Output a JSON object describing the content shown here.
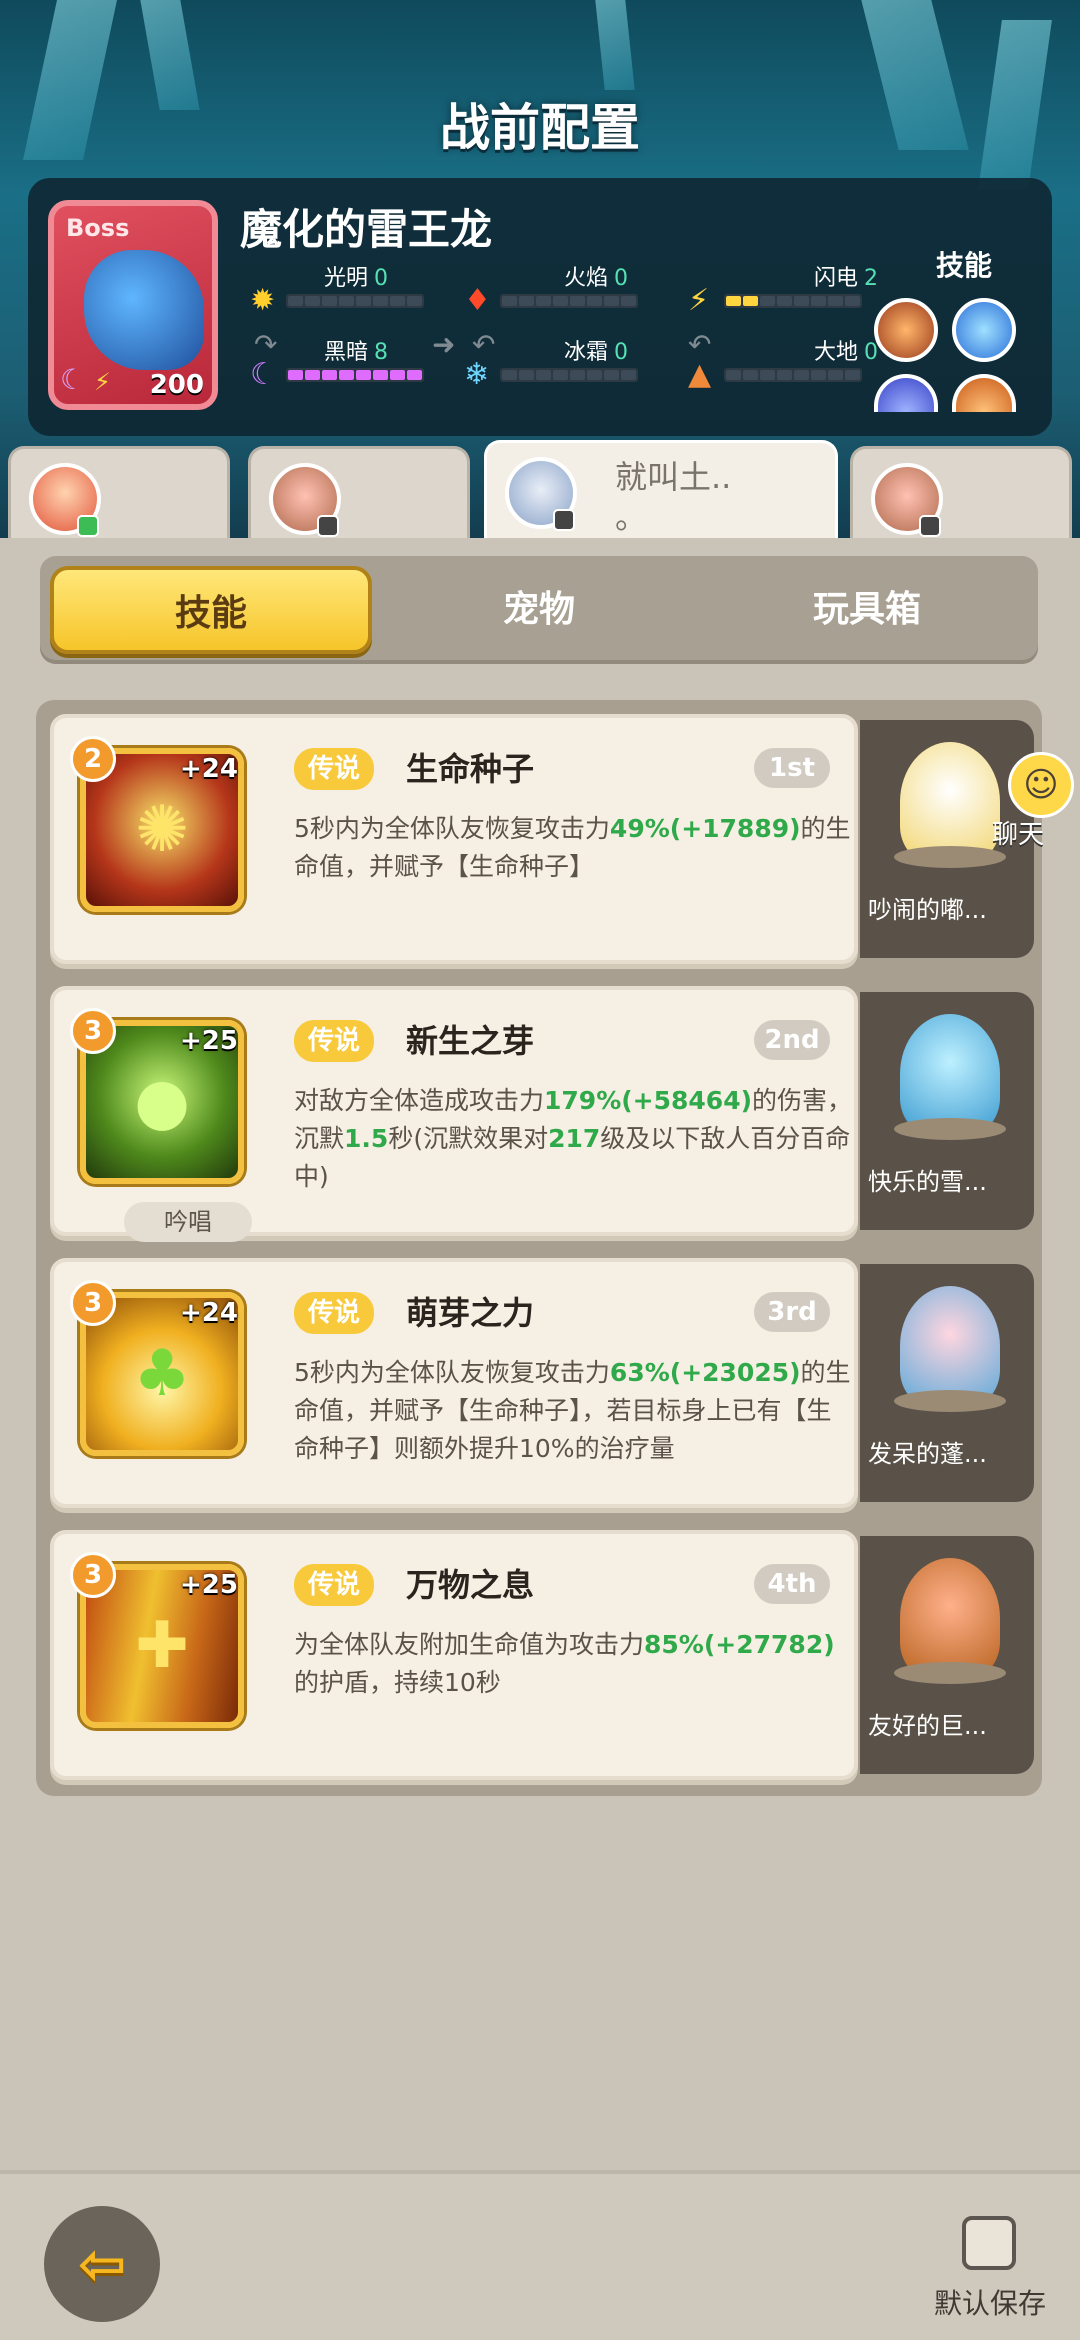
{
  "header": {
    "title": "战前配置"
  },
  "boss": {
    "tag": "Boss",
    "name": "魔化的雷王龙",
    "level": "200",
    "elements": [
      {
        "label": "光明",
        "value": "0",
        "icon": "sun-icon",
        "filled": 0
      },
      {
        "label": "火焰",
        "value": "0",
        "icon": "flame-icon",
        "filled": 0
      },
      {
        "label": "闪电",
        "value": "2",
        "icon": "bolt-icon",
        "filled": 2
      },
      {
        "label": "黑暗",
        "value": "8",
        "icon": "moon-icon",
        "filled": 8
      },
      {
        "label": "冰霜",
        "value": "0",
        "icon": "snowflake-icon",
        "filled": 0
      },
      {
        "label": "大地",
        "value": "0",
        "icon": "mountain-icon",
        "filled": 0
      }
    ],
    "skills_label": "技能"
  },
  "party": {
    "tabs": [
      {
        "name": ""
      },
      {
        "name": ""
      },
      {
        "name": "就叫土..\n。"
      },
      {
        "name": ""
      }
    ]
  },
  "tabs": [
    {
      "label": "技能",
      "active": true
    },
    {
      "label": "宠物",
      "active": false
    },
    {
      "label": "玩具箱",
      "active": false
    }
  ],
  "skills": [
    {
      "cost": "2",
      "bonus": "+24",
      "tag": "传说",
      "name": "生命种子",
      "rank": "1st",
      "desc_a": "5秒内为全体队友恢复攻击力",
      "num1": "49%",
      "num2": "(+17889)",
      "desc_b": "的生命值，并赋予【生命种子】",
      "pet": "吵闹的嘟..."
    },
    {
      "cost": "3",
      "bonus": "+25",
      "tag": "传说",
      "name": "新生之芽",
      "rank": "2nd",
      "desc_a": "对敌方全体造成攻击力",
      "num1": "179%",
      "num2": "(+58464)",
      "desc_b": "的伤害，沉默",
      "num3": "1.5",
      "desc_c": "秒(沉默效果对",
      "num4": "217",
      "desc_d": "级及以下敌人百分百命中)",
      "chant": "吟唱",
      "pet": "快乐的雪..."
    },
    {
      "cost": "3",
      "bonus": "+24",
      "tag": "传说",
      "name": "萌芽之力",
      "rank": "3rd",
      "desc_a": "5秒内为全体队友恢复攻击力",
      "num1": "63%",
      "num2": "(+23025)",
      "desc_b": "的生命值，并赋予【生命种子】，若目标身上已有【生命种子】则额外提升10%的治疗量",
      "pet": "发呆的蓬..."
    },
    {
      "cost": "3",
      "bonus": "+25",
      "tag": "传说",
      "name": "万物之息",
      "rank": "4th",
      "desc_a": "为全体队友附加生命值为攻击力",
      "num1": "85%",
      "num2": "(+27782)",
      "desc_b": "的护盾，持续10秒",
      "pet": "友好的巨..."
    }
  ],
  "chat": {
    "label": "聊天"
  },
  "footer": {
    "save_label": "默认保存"
  },
  "colors": {
    "accent_gold": "#f6c52a",
    "value_green": "#2fa94a",
    "element_value": "#56e0b3",
    "dark_element": "#e06bff"
  }
}
